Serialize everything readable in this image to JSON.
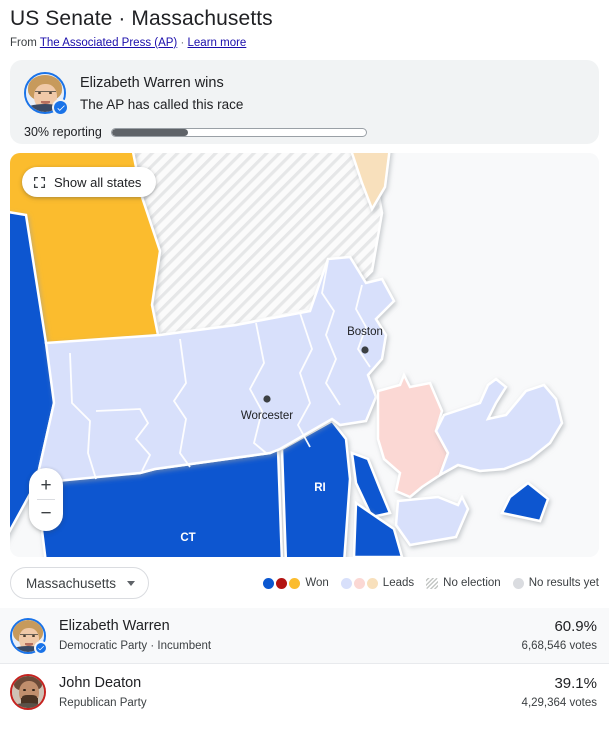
{
  "header": {
    "title": "US Senate · Massachusetts",
    "source_prefix": "From",
    "source_name": "The Associated Press (AP)",
    "separator": "·",
    "learn_more": "Learn more"
  },
  "called_card": {
    "headline": "Elizabeth Warren wins",
    "subtext": "The AP has called this race",
    "reporting_label": "30% reporting",
    "reporting_percent": 30,
    "verified_icon": "check-badge-icon"
  },
  "map": {
    "show_all_states_label": "Show all states",
    "show_all_states_icon": "expand-icon",
    "zoom_in_label": "+",
    "zoom_out_label": "−",
    "cities": [
      {
        "name": "Boston"
      },
      {
        "name": "Worcester"
      }
    ],
    "state_labels": [
      {
        "name": "RI"
      },
      {
        "name": "CT"
      }
    ],
    "colors": {
      "won_dem": "#0b57d0",
      "won_rep": "#b31412",
      "won_other": "#fbbc2e",
      "leads_dem": "#d8e0fb",
      "leads_rep": "#fbd8d4",
      "leads_other": "#f8e0bc",
      "no_results": "#dadce0",
      "map_background": "#f8f9fa"
    }
  },
  "controls": {
    "state_select_value": "Massachusetts",
    "state_select_icon": "chevron-down-icon"
  },
  "legend": [
    {
      "label": "Won",
      "type": "dots",
      "colors": [
        "#0b57d0",
        "#b31412",
        "#fbbc2e"
      ]
    },
    {
      "label": "Leads",
      "type": "dots",
      "colors": [
        "#d8e0fb",
        "#fbd8d4",
        "#f8e0bc"
      ]
    },
    {
      "label": "No election",
      "type": "hatch",
      "colors": []
    },
    {
      "label": "No results yet",
      "type": "dots",
      "colors": [
        "#dadce0"
      ]
    }
  ],
  "results": [
    {
      "name": "Elizabeth Warren",
      "party": "Democratic Party · Incumbent",
      "percent": "60.9%",
      "votes": "6,68,546 votes",
      "winner": true,
      "accent": "#1a73e8"
    },
    {
      "name": "John Deaton",
      "party": "Republican Party",
      "percent": "39.1%",
      "votes": "4,29,364 votes",
      "winner": false,
      "accent": "#c5221f"
    }
  ]
}
